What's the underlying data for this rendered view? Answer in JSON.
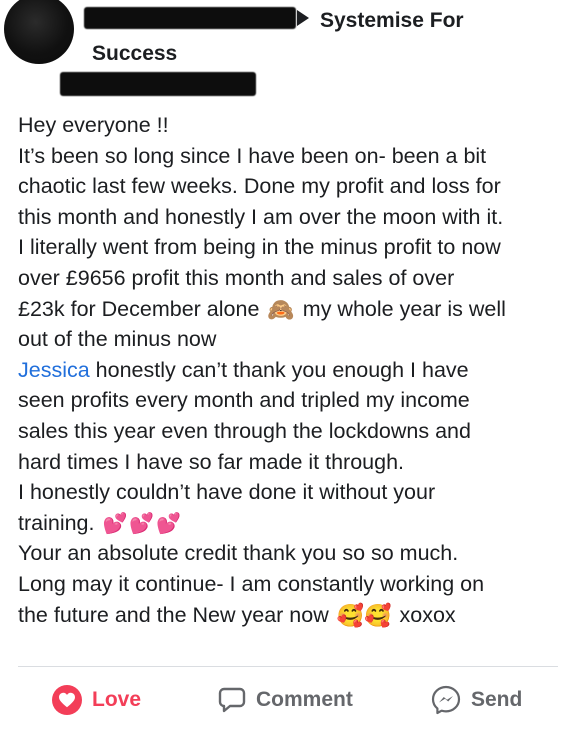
{
  "header": {
    "group_name_line1": "Systemise For",
    "group_name_line2": "Success"
  },
  "post": {
    "lines": [
      "Hey everyone !!",
      "It’s been so long since I have been on- been a bit",
      "chaotic last few weeks. Done my profit and loss for",
      "this month and honestly I am over the moon with it.",
      "I literally went from being in the minus profit to now",
      "over £9656 profit this month and sales of over"
    ],
    "line7_before": "£23k for December alone",
    "line7_emoji": "🙈",
    "line7_after": "my whole year is well",
    "line8": "out of the minus now",
    "mention": "Jessica",
    "line9_after": " honestly can’t thank you enough I have",
    "lines_b": [
      "seen profits every month and tripled my income",
      "sales this year even through the lockdowns and",
      "hard times I have so far made it through.",
      "I honestly couldn’t have done it without your"
    ],
    "line14": "training.",
    "line14_emoji": "💕💕💕",
    "lines_c": [
      "Your an absolute credit thank you so so much.",
      "Long may it continue- I am constantly working on"
    ],
    "line17": "the future and the New year now",
    "line17_emoji": "🥰🥰",
    "line17_end": "xoxox"
  },
  "actions": {
    "love_label": "Love",
    "comment_label": "Comment",
    "send_label": "Send"
  },
  "colors": {
    "love": "#f33e58",
    "mention": "#216fdb",
    "action_text": "#65676b"
  }
}
